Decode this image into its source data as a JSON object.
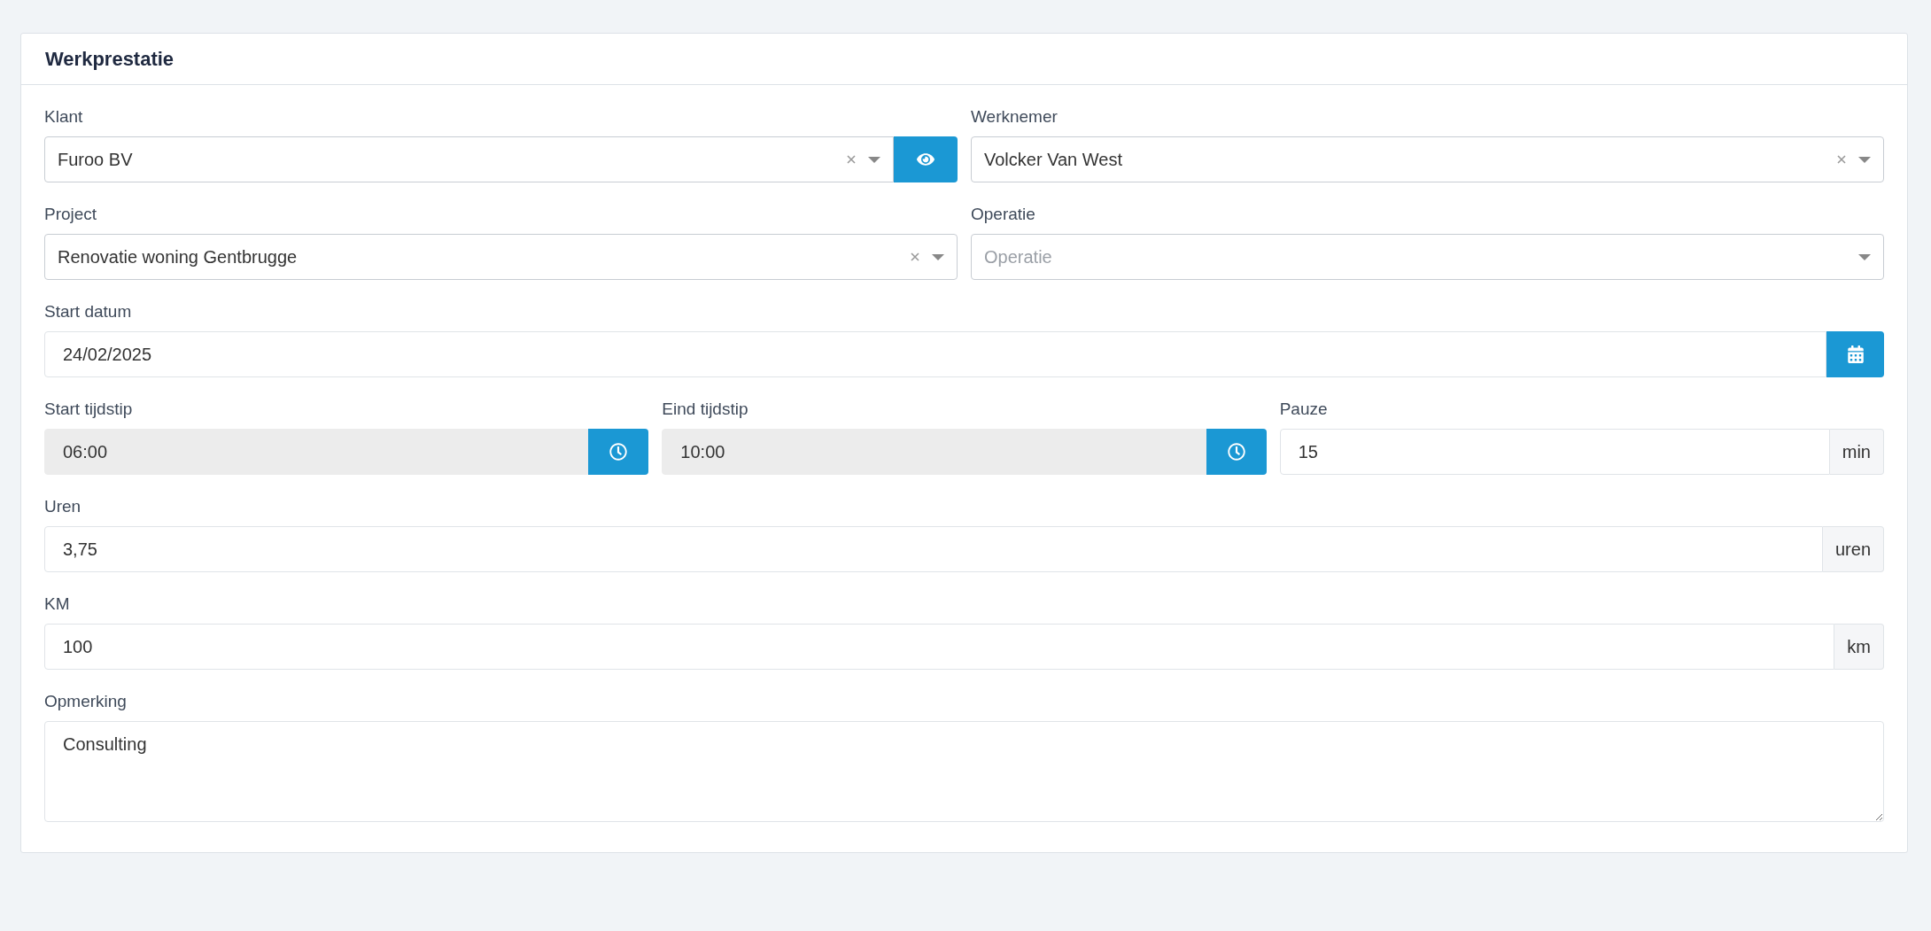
{
  "card": {
    "title": "Werkprestatie"
  },
  "rows": [
    {
      "fields": [
        {
          "kind": "select",
          "label": "Klant",
          "value": "Furoo BV",
          "clearable": true,
          "view_button": true
        },
        {
          "kind": "select",
          "label": "Werknemer",
          "value": "Volcker Van West",
          "clearable": true,
          "view_button": false
        }
      ]
    },
    {
      "fields": [
        {
          "kind": "select",
          "label": "Project",
          "value": "Renovatie woning Gentbrugge",
          "clearable": true,
          "view_button": false
        },
        {
          "kind": "select",
          "label": "Operatie",
          "placeholder": "Operatie",
          "clearable": false,
          "view_button": false
        }
      ]
    },
    {
      "fields": [
        {
          "kind": "date",
          "label": "Start datum",
          "value": "24/02/2025"
        }
      ]
    },
    {
      "fields": [
        {
          "kind": "time",
          "label": "Start tijdstip",
          "value": "06:00",
          "readonly": true
        },
        {
          "kind": "time",
          "label": "Eind tijdstip",
          "value": "10:00",
          "readonly": true
        },
        {
          "kind": "unit",
          "label": "Pauze",
          "value": "15",
          "unit": "min"
        }
      ]
    },
    {
      "fields": [
        {
          "kind": "unit",
          "label": "Uren",
          "value": "3,75",
          "unit": "uren"
        }
      ]
    },
    {
      "fields": [
        {
          "kind": "unit",
          "label": "KM",
          "value": "100",
          "unit": "km"
        }
      ]
    },
    {
      "fields": [
        {
          "kind": "textarea",
          "label": "Opmerking",
          "value": "Consulting"
        }
      ]
    }
  ]
}
